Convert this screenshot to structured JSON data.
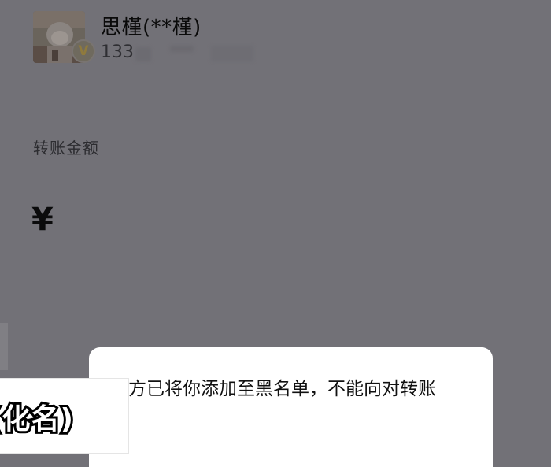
{
  "contact": {
    "name": "思槿(**槿)",
    "account_prefix": "133",
    "badge_icon": "verified-v-icon"
  },
  "transfer": {
    "amount_label": "转账金额",
    "currency_symbol": "¥"
  },
  "dialog": {
    "message": "方已将你添加至黑名单，不能向对转账"
  },
  "caption": {
    "text": "(化名)"
  },
  "colors": {
    "backdrop": "#727177",
    "dialog": "#ffffff"
  }
}
